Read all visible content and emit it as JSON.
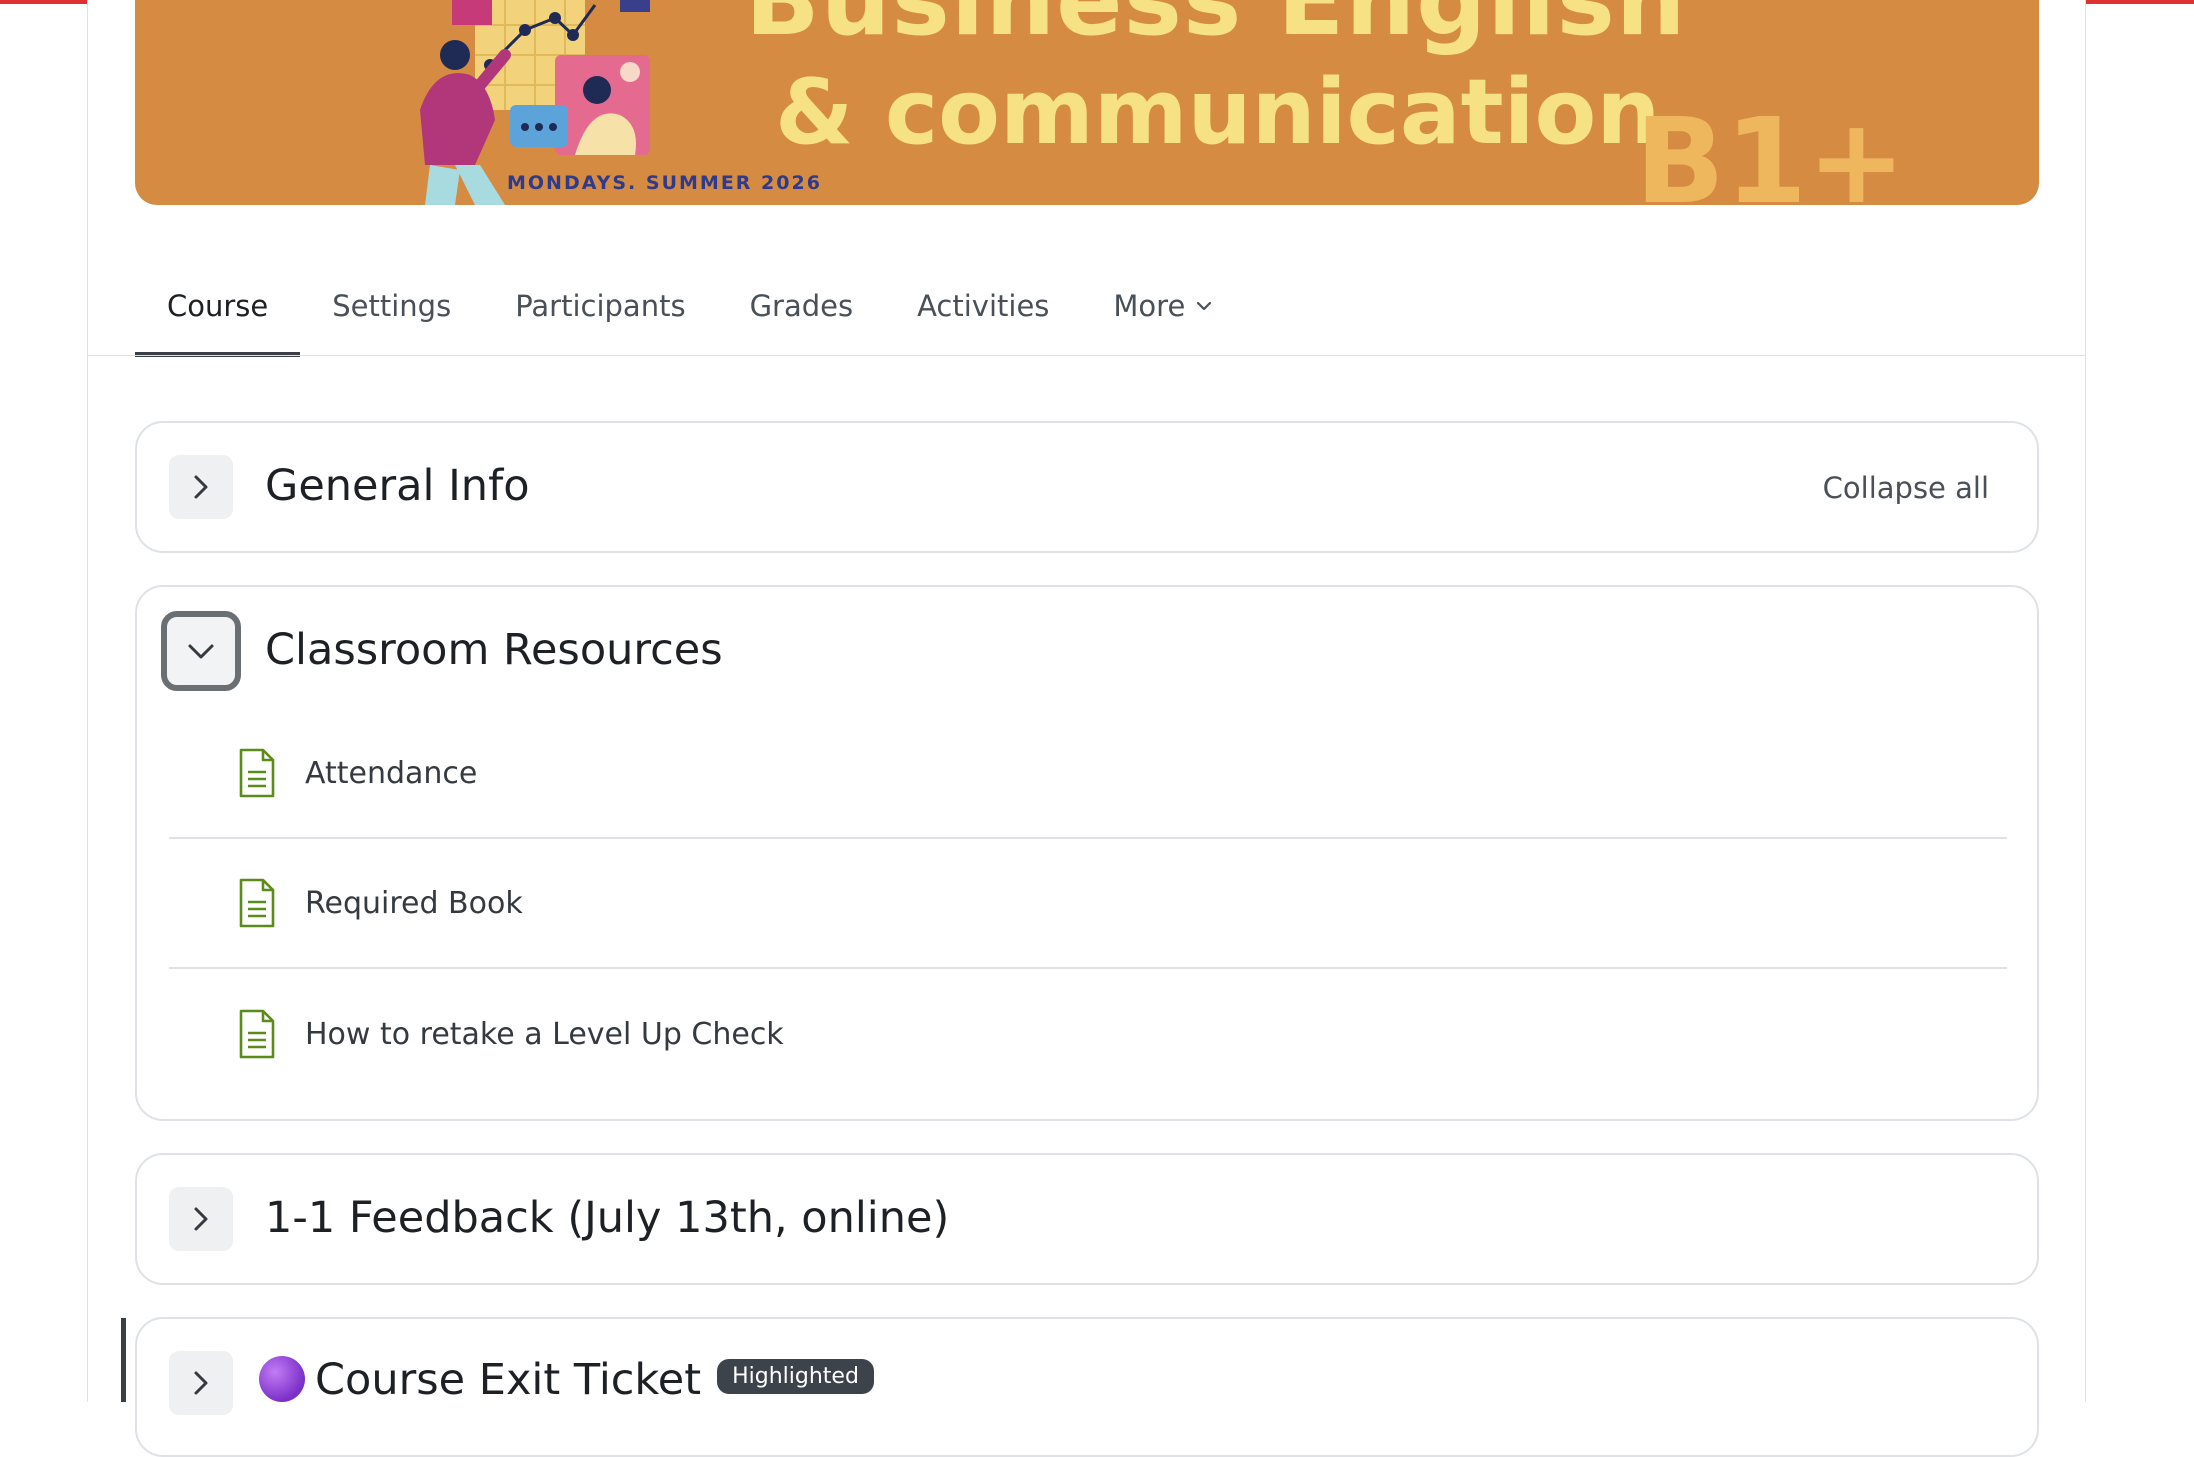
{
  "banner": {
    "title_line1": "Business English",
    "title_line2": "& communication",
    "level": "B1+",
    "tagline": "MONDAYS. SUMMER 2026"
  },
  "tabs": [
    {
      "label": "Course",
      "active": true
    },
    {
      "label": "Settings",
      "active": false
    },
    {
      "label": "Participants",
      "active": false
    },
    {
      "label": "Grades",
      "active": false
    },
    {
      "label": "Activities",
      "active": false
    },
    {
      "label": "More",
      "active": false
    }
  ],
  "sections": {
    "general_info": {
      "title": "General Info",
      "collapse_all": "Collapse all",
      "expanded": false
    },
    "classroom_resources": {
      "title": "Classroom Resources",
      "expanded": true,
      "activities": [
        {
          "name": "Attendance",
          "icon": "file-document-icon"
        },
        {
          "name": "Required Book",
          "icon": "file-document-icon"
        },
        {
          "name": "How to retake a Level Up Check",
          "icon": "file-document-icon"
        }
      ]
    },
    "feedback": {
      "title": "1-1 Feedback (July 13th, online)",
      "expanded": false
    },
    "exit_ticket": {
      "title": "Course Exit Ticket",
      "badge": "Highlighted",
      "icon": "purple-circle-icon",
      "expanded": false
    }
  },
  "colors": {
    "top_bar": "#e03131",
    "banner_bg": "#d68b42",
    "banner_text": "#f6e184",
    "icon_green": "#5b8c1a",
    "badge_bg": "#3d434a"
  }
}
